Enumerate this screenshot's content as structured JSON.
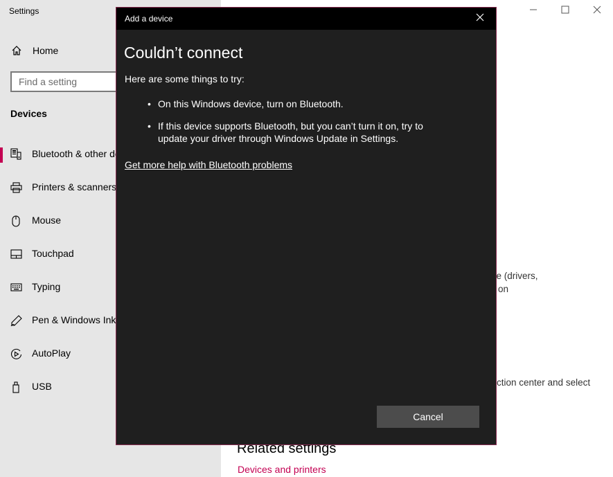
{
  "app": {
    "title": "Settings"
  },
  "window_controls": {
    "minimize_icon": "minimize-icon",
    "maximize_icon": "maximize-icon",
    "close_icon": "close-icon"
  },
  "sidebar": {
    "home_label": "Home",
    "search_placeholder": "Find a setting",
    "section_title": "Devices",
    "items": [
      {
        "label": "Bluetooth & other devices",
        "icon": "bluetooth-devices-icon",
        "active": true
      },
      {
        "label": "Printers & scanners",
        "icon": "printer-icon",
        "active": false
      },
      {
        "label": "Mouse",
        "icon": "mouse-icon",
        "active": false
      },
      {
        "label": "Touchpad",
        "icon": "touchpad-icon",
        "active": false
      },
      {
        "label": "Typing",
        "icon": "keyboard-icon",
        "active": false
      },
      {
        "label": "Pen & Windows Ink",
        "icon": "pen-icon",
        "active": false
      },
      {
        "label": "AutoPlay",
        "icon": "autoplay-icon",
        "active": false
      },
      {
        "label": "USB",
        "icon": "usb-icon",
        "active": false
      }
    ]
  },
  "main": {
    "partial_text_1": "re (drivers,",
    "partial_text_2": "on",
    "partial_text_3": "ction center and select",
    "related_title": "Related settings",
    "related_link": "Devices and printers"
  },
  "dialog": {
    "title": "Add a device",
    "heading": "Couldn’t connect",
    "intro": "Here are some things to try:",
    "tips": [
      "On this Windows device, turn on Bluetooth.",
      "If this device supports Bluetooth, but you can’t turn it on, try to update your driver through Windows Update in Settings."
    ],
    "help_link": "Get more help with Bluetooth problems",
    "cancel_label": "Cancel"
  },
  "colors": {
    "accent": "#c30052",
    "dialog_bg": "#1f1f1f",
    "titlebar_bg": "#000000",
    "button_bg": "#4c4c4c",
    "sidebar_bg": "#e6e6e6"
  }
}
